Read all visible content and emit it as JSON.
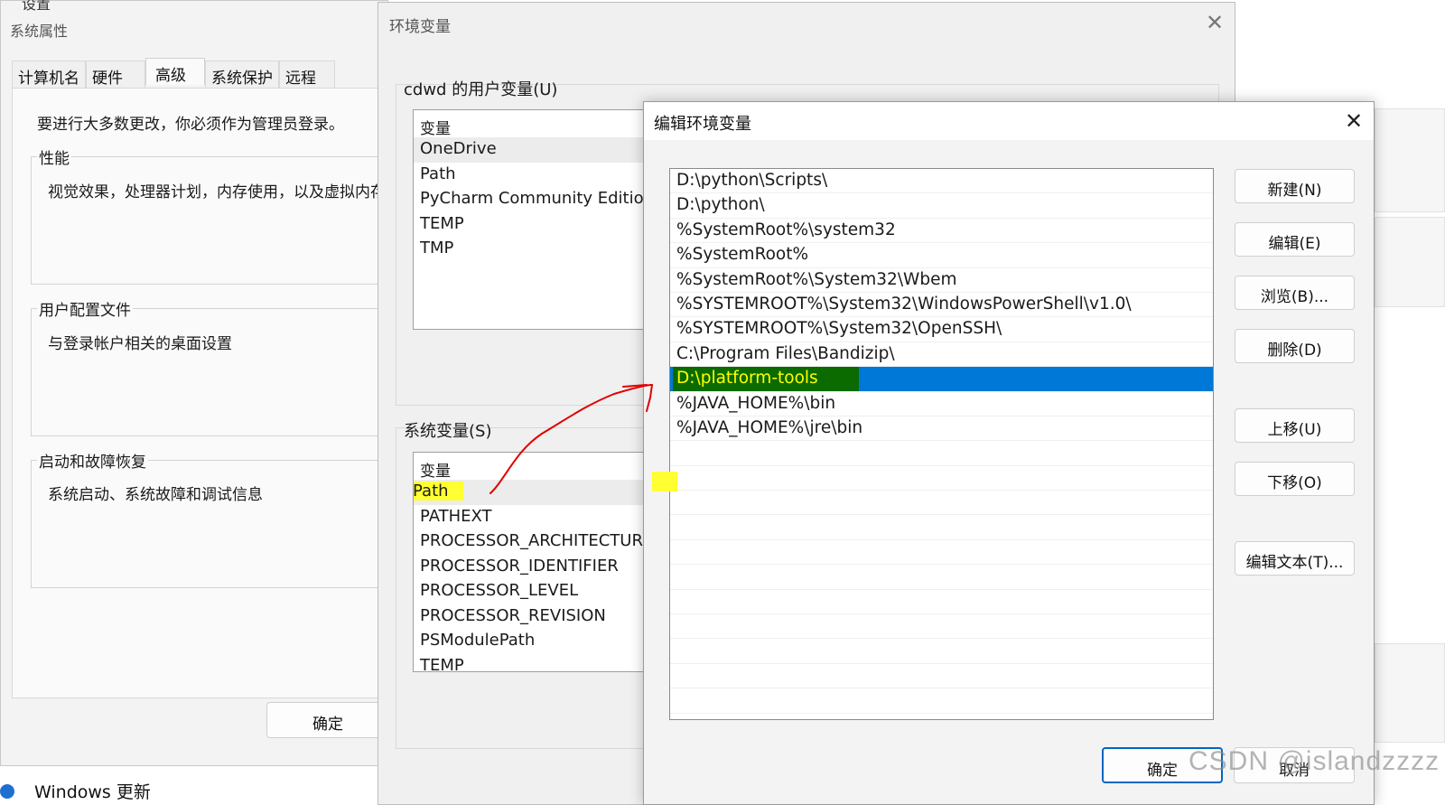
{
  "sys_props": {
    "clip_title": "设置",
    "title": "系统属性",
    "tabs": [
      "计算机名",
      "硬件",
      "高级",
      "系统保护",
      "远程"
    ],
    "admin_note": "要进行大多数更改，你必须作为管理员登录。",
    "performance": {
      "title": "性能",
      "text": "视觉效果，处理器计划，内存使用，以及虚拟内存"
    },
    "profiles": {
      "title": "用户配置文件",
      "text": "与登录帐户相关的桌面设置"
    },
    "startup": {
      "title": "启动和故障恢复",
      "text": "系统启动、系统故障和调试信息"
    },
    "ok_label": "确定",
    "windows_update": "Windows 更新"
  },
  "env": {
    "title": "环境变量",
    "close": "✕",
    "user_vars_label": "cdwd 的用户变量(U)",
    "user_header": "变量",
    "user_vars": [
      "OneDrive",
      "Path",
      "PyCharm Community Edition",
      "TEMP",
      "TMP"
    ],
    "sys_vars_label": "系统变量(S)",
    "sys_header": "变量",
    "sys_vars": [
      "Path",
      "PATHEXT",
      "PROCESSOR_ARCHITECTURE",
      "PROCESSOR_IDENTIFIER",
      "PROCESSOR_LEVEL",
      "PROCESSOR_REVISION",
      "PSModulePath",
      "TEMP"
    ]
  },
  "edit": {
    "title": "编辑环境变量",
    "close": "✕",
    "paths": [
      "D:\\python\\Scripts\\",
      "D:\\python\\",
      "%SystemRoot%\\system32",
      "%SystemRoot%",
      "%SystemRoot%\\System32\\Wbem",
      "%SYSTEMROOT%\\System32\\WindowsPowerShell\\v1.0\\",
      "%SYSTEMROOT%\\System32\\OpenSSH\\",
      "C:\\Program Files\\Bandizip\\",
      "D:\\platform-tools",
      "%JAVA_HOME%\\bin",
      "%JAVA_HOME%\\jre\\bin"
    ],
    "selected_index": 8,
    "buttons": {
      "new": "新建(N)",
      "edit": "编辑(E)",
      "browse": "浏览(B)...",
      "delete": "删除(D)",
      "move_up": "上移(U)",
      "move_down": "下移(O)",
      "edit_text": "编辑文本(T)..."
    },
    "ok": "确定",
    "cancel": "取消"
  },
  "watermark": "CSDN @islandzzzz",
  "colors": {
    "selection": "#0078d7",
    "highlight": "#ffff33",
    "annotation": "#e00000"
  }
}
